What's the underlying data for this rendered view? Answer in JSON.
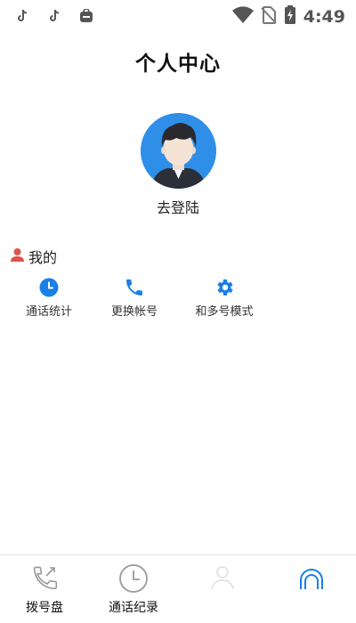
{
  "status_bar": {
    "time": "4:49",
    "left_icons": [
      "tiktok-icon",
      "tiktok-icon",
      "store-icon"
    ],
    "right_icons": [
      "wifi-icon",
      "no-sim-icon",
      "battery-charging-icon"
    ]
  },
  "header": {
    "title": "个人中心"
  },
  "profile": {
    "login_label": "去登陆",
    "avatar_bg": "#2f8fe8"
  },
  "my_section": {
    "title": "我的",
    "title_icon_color": "#e0524a",
    "items": [
      {
        "label": "通话统计",
        "icon": "clock-icon"
      },
      {
        "label": "更换帐号",
        "icon": "phone-icon"
      },
      {
        "label": "和多号模式",
        "icon": "gear-icon"
      }
    ],
    "accent": "#1a7fe6"
  },
  "bottom_nav": {
    "items": [
      {
        "label": "拨号盘",
        "icon": "dialer-phone-icon"
      },
      {
        "label": "通话纪录",
        "icon": "clock-icon"
      },
      {
        "label": "",
        "icon": "contacts-icon"
      },
      {
        "label": "",
        "icon": "profile-icon",
        "active": true
      }
    ]
  }
}
